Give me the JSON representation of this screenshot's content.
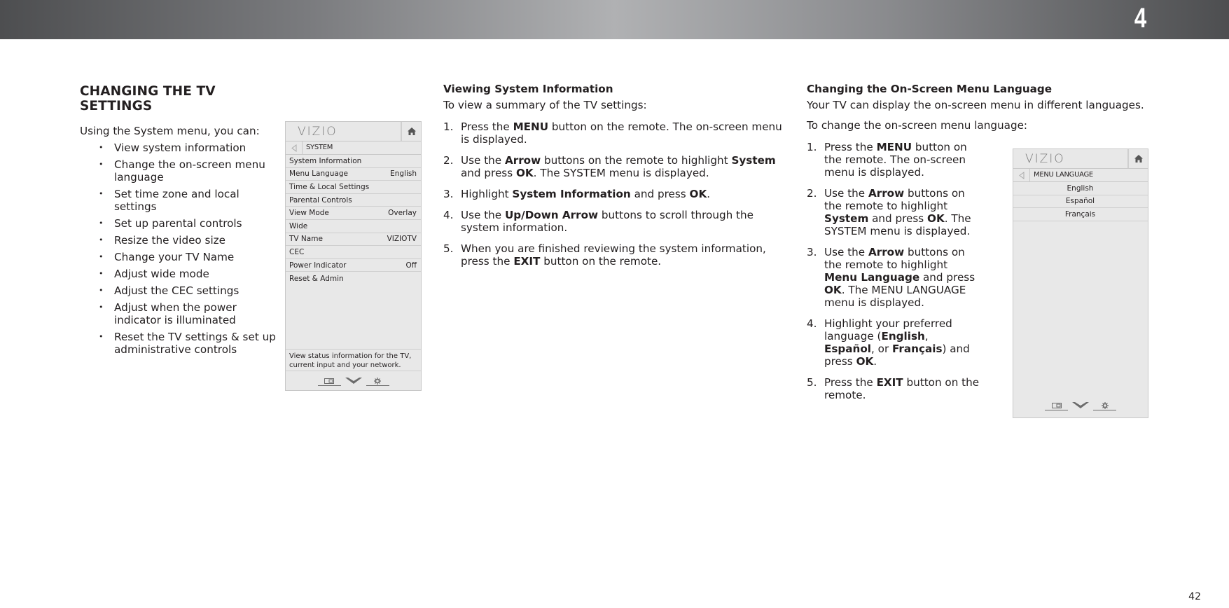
{
  "header": {
    "chapter_number": "4"
  },
  "page_number": "42",
  "left_column": {
    "title": "CHANGING THE TV SETTINGS",
    "intro": "Using the System menu, you can:",
    "bullets": [
      "View system information",
      "Change the on-screen menu language",
      "Set time zone and local settings",
      "Set up parental controls",
      "Resize the video size",
      "Change your TV Name",
      "Adjust wide mode",
      "Adjust the CEC settings",
      "Adjust when the power indicator is illuminated",
      "Reset the TV settings & set up administrative controls"
    ]
  },
  "system_menu": {
    "logo": "VIZIO",
    "title": "SYSTEM",
    "items": [
      {
        "label": "System Information",
        "value": ""
      },
      {
        "label": "Menu Language",
        "value": "English"
      },
      {
        "label": "Time & Local Settings",
        "value": ""
      },
      {
        "label": "Parental Controls",
        "value": ""
      },
      {
        "label": "View Mode",
        "value": "Overlay"
      },
      {
        "label": "Wide",
        "value": ""
      },
      {
        "label": "TV Name",
        "value": "VIZIOTV"
      },
      {
        "label": "CEC",
        "value": ""
      },
      {
        "label": "Power Indicator",
        "value": "Off"
      },
      {
        "label": "Reset & Admin",
        "value": ""
      }
    ],
    "description": "View status information for the TV, current input and your network.",
    "icons": {
      "home": "home-icon",
      "back": "back-arrow-icon",
      "input": "input-icon",
      "menu": "chevron-down-icon",
      "settings": "gear-icon"
    }
  },
  "viewing_section": {
    "title": "Viewing System Information",
    "intro": "To view a summary of the TV settings:",
    "steps": [
      {
        "num": "1.",
        "parts": [
          "Press the ",
          "MENU",
          " button on the remote. The on-screen menu is displayed."
        ]
      },
      {
        "num": "2.",
        "parts": [
          "Use the ",
          "Arrow",
          " buttons on the remote to highlight ",
          "System",
          " and press ",
          "OK",
          ". The SYSTEM menu is displayed."
        ]
      },
      {
        "num": "3.",
        "parts": [
          "Highlight ",
          "System Information",
          " and press ",
          "OK",
          "."
        ]
      },
      {
        "num": "4.",
        "parts": [
          "Use the ",
          "Up/Down Arrow",
          " buttons to scroll through the system information."
        ]
      },
      {
        "num": "5.",
        "parts": [
          "When you are finished reviewing the system information, press the ",
          "EXIT",
          " button on the remote."
        ]
      }
    ]
  },
  "language_section": {
    "title": "Changing the On-Screen Menu Language",
    "intro1": "Your TV can display the on-screen menu in different languages.",
    "intro2": "To change the on-screen menu language:",
    "steps": [
      {
        "num": "1.",
        "parts": [
          "Press the ",
          "MENU",
          " button on the remote. The on-screen menu is displayed."
        ]
      },
      {
        "num": "2.",
        "parts": [
          "Use the ",
          "Arrow",
          " buttons on the remote to highlight ",
          "System",
          " and press ",
          "OK",
          ". The SYSTEM menu is displayed."
        ]
      },
      {
        "num": "3.",
        "parts": [
          "Use the ",
          "Arrow",
          " buttons on the remote to highlight ",
          "Menu Language",
          " and press ",
          "OK",
          ". The MENU LANGUAGE menu is displayed."
        ]
      },
      {
        "num": "4.",
        "parts": [
          "Highlight your preferred language (",
          "English",
          ", ",
          "Español",
          ", or ",
          "Français",
          ") and press ",
          "OK",
          "."
        ]
      },
      {
        "num": "5.",
        "parts": [
          "Press the ",
          "EXIT",
          " button on the remote."
        ]
      }
    ]
  },
  "language_menu": {
    "logo": "VIZIO",
    "title": "MENU LANGUAGE",
    "options": [
      "English",
      "Español",
      "Français"
    ]
  }
}
